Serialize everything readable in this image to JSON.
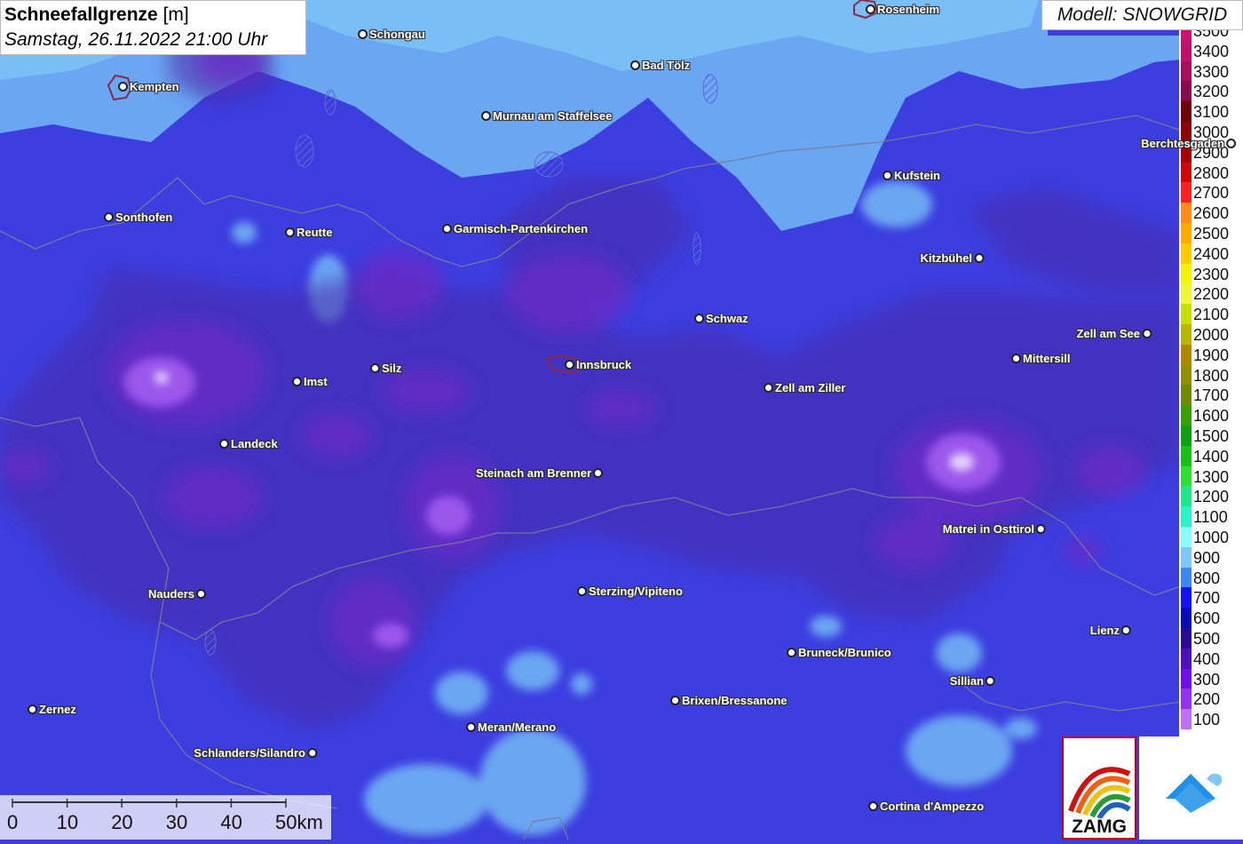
{
  "title": {
    "main": "Schneefallgrenze",
    "unit": "[m]",
    "datetime": "Samstag, 26.11.2022 21:00 Uhr"
  },
  "model_label": "Modell: SNOWGRID",
  "legend": [
    {
      "value": "3500",
      "color": "#d0106e"
    },
    {
      "value": "3400",
      "color": "#c0106a"
    },
    {
      "value": "3300",
      "color": "#a8105e"
    },
    {
      "value": "3200",
      "color": "#8a0a50"
    },
    {
      "value": "3100",
      "color": "#6e0606"
    },
    {
      "value": "3000",
      "color": "#8c0404"
    },
    {
      "value": "2900",
      "color": "#aa0202"
    },
    {
      "value": "2800",
      "color": "#d00808"
    },
    {
      "value": "2700",
      "color": "#ff2020"
    },
    {
      "value": "2600",
      "color": "#ff8c18"
    },
    {
      "value": "2500",
      "color": "#ffaa00"
    },
    {
      "value": "2400",
      "color": "#ffcc00"
    },
    {
      "value": "2300",
      "color": "#f4f400"
    },
    {
      "value": "2200",
      "color": "#ecf838"
    },
    {
      "value": "2100",
      "color": "#c8e000"
    },
    {
      "value": "2000",
      "color": "#b8b800"
    },
    {
      "value": "1900",
      "color": "#b08800"
    },
    {
      "value": "1800",
      "color": "#909000"
    },
    {
      "value": "1700",
      "color": "#6e8a00"
    },
    {
      "value": "1600",
      "color": "#38a000"
    },
    {
      "value": "1500",
      "color": "#10a010"
    },
    {
      "value": "1400",
      "color": "#18c018"
    },
    {
      "value": "1300",
      "color": "#30e030"
    },
    {
      "value": "1200",
      "color": "#20e888"
    },
    {
      "value": "1100",
      "color": "#28f4c8"
    },
    {
      "value": "1000",
      "color": "#88ffff"
    },
    {
      "value": "900",
      "color": "#7ec8f8"
    },
    {
      "value": "800",
      "color": "#3a88f0"
    },
    {
      "value": "700",
      "color": "#1414f0"
    },
    {
      "value": "600",
      "color": "#0a0ab8"
    },
    {
      "value": "500",
      "color": "#2a0a90"
    },
    {
      "value": "400",
      "color": "#5010b8"
    },
    {
      "value": "300",
      "color": "#7010e8"
    },
    {
      "value": "200",
      "color": "#9830f4"
    },
    {
      "value": "100",
      "color": "#c070f8"
    }
  ],
  "scale": {
    "ticks": [
      "0",
      "10",
      "20",
      "30",
      "40",
      "50km"
    ]
  },
  "cities": [
    {
      "name": "Rosenheim",
      "side": "right"
    },
    {
      "name": "Schongau",
      "side": "right"
    },
    {
      "name": "Kempten",
      "side": "right"
    },
    {
      "name": "Bad Tölz",
      "side": "right"
    },
    {
      "name": "Murnau am Staffelsee",
      "side": "right"
    },
    {
      "name": "Berchtesgaden",
      "side": "left"
    },
    {
      "name": "Kufstein",
      "side": "right"
    },
    {
      "name": "Sonthofen",
      "side": "right"
    },
    {
      "name": "Reutte",
      "side": "right"
    },
    {
      "name": "Garmisch-Partenkirchen",
      "side": "right"
    },
    {
      "name": "Kitzbühel",
      "side": "left"
    },
    {
      "name": "Schwaz",
      "side": "right"
    },
    {
      "name": "Zell am See",
      "side": "left"
    },
    {
      "name": "Mittersill",
      "side": "right"
    },
    {
      "name": "Innsbruck",
      "side": "right"
    },
    {
      "name": "Silz",
      "side": "right"
    },
    {
      "name": "Imst",
      "side": "right"
    },
    {
      "name": "Zell am Ziller",
      "side": "right"
    },
    {
      "name": "Landeck",
      "side": "right"
    },
    {
      "name": "Steinach am Brenner",
      "side": "left"
    },
    {
      "name": "Matrei in Osttirol",
      "side": "left"
    },
    {
      "name": "Nauders",
      "side": "left"
    },
    {
      "name": "Sterzing/Vipiteno",
      "side": "right"
    },
    {
      "name": "Lienz",
      "side": "left"
    },
    {
      "name": "Bruneck/Brunico",
      "side": "right"
    },
    {
      "name": "Sillian",
      "side": "left"
    },
    {
      "name": "Brixen/Bressanone",
      "side": "right"
    },
    {
      "name": "Zernez",
      "side": "right"
    },
    {
      "name": "Meran/Merano",
      "side": "right"
    },
    {
      "name": "Schlanders/Silandro",
      "side": "left"
    },
    {
      "name": "Cortina d'Ampezzo",
      "side": "right"
    }
  ],
  "logos": {
    "zamg_text": "ZAMG",
    "geosphere": "geosphere-logo-icon"
  }
}
